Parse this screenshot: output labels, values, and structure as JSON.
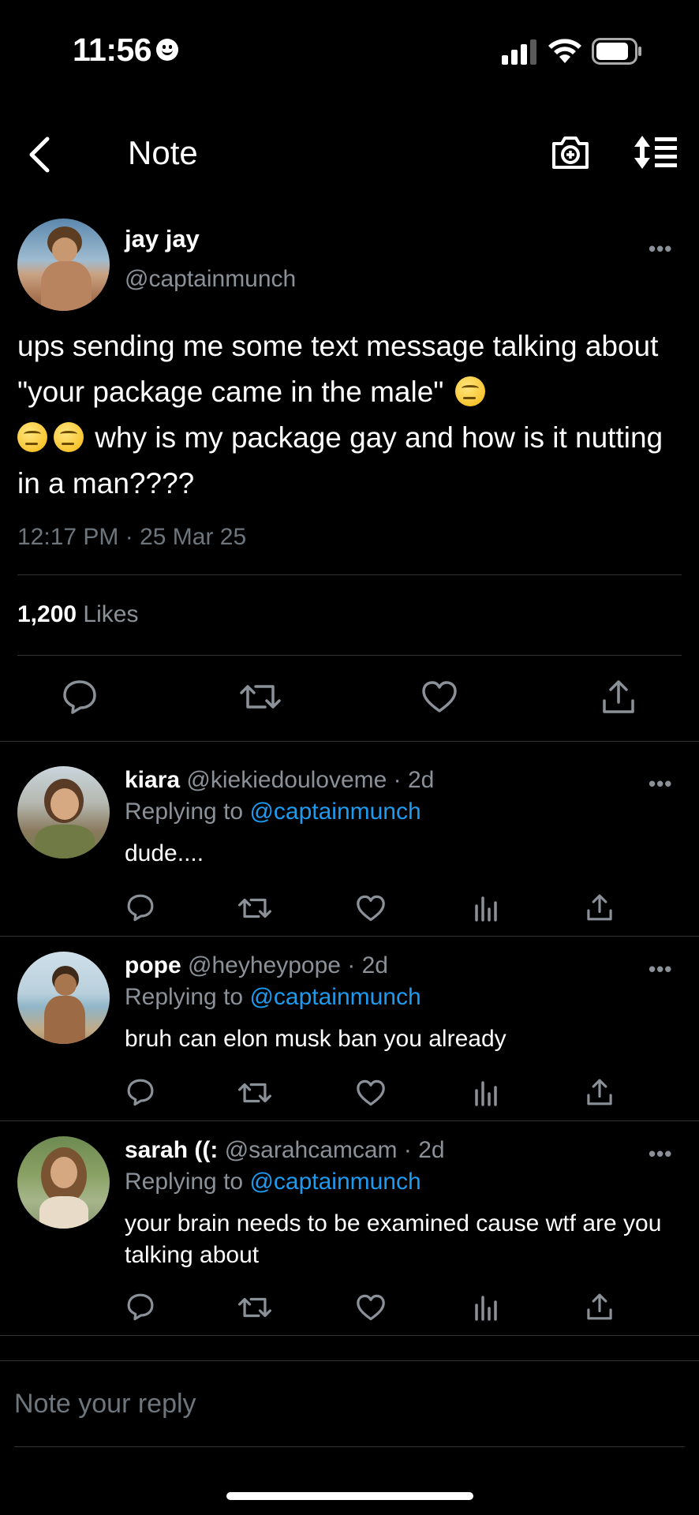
{
  "status_bar": {
    "time": "11:56"
  },
  "header": {
    "title": "Note"
  },
  "main_tweet": {
    "name": "jay jay",
    "handle": "@captainmunch",
    "text_part1": "ups sending me some text message talking about \"your package came in the male\"",
    "text_part2": "why is my package gay and how is it nutting in a man????",
    "timestamp": "12:17 PM · 25 Mar 25",
    "likes_count": "1,200",
    "likes_label": "Likes"
  },
  "replies": [
    {
      "name": "kiara",
      "meta": "@kiekiedouloveme · 2d",
      "replying_prefix": "Replying to",
      "mention": "@captainmunch",
      "text": "dude...."
    },
    {
      "name": "pope",
      "meta": "@heyheypope · 2d",
      "replying_prefix": "Replying to",
      "mention": "@captainmunch",
      "text": "bruh can elon musk ban you already"
    },
    {
      "name": "sarah ((:",
      "meta": "@sarahcamcam · 2d",
      "replying_prefix": "Replying to",
      "mention": "@captainmunch",
      "text": "your brain needs to be examined cause wtf are you talking about"
    }
  ],
  "reply_box": {
    "placeholder": "Note your reply"
  },
  "colors": {
    "background": "#000000",
    "accent": "#1d9bf0",
    "secondary_text": "#8b9198",
    "divider": "#2f3336"
  }
}
